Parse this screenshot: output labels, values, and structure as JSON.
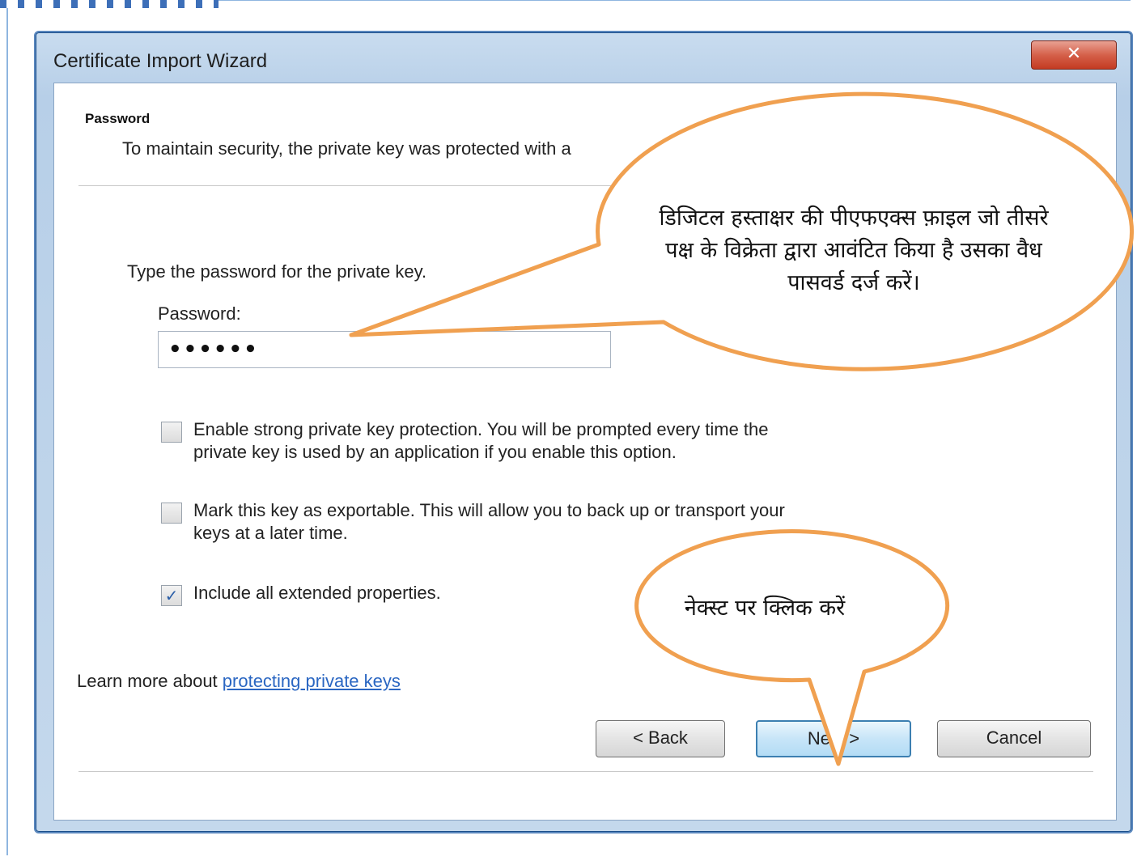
{
  "window": {
    "title": "Certificate Import Wizard",
    "close_label": "✕"
  },
  "header": {
    "title": "Password",
    "description": "To maintain security, the private key was protected with a"
  },
  "form": {
    "instruction": "Type the password for the private key.",
    "password_label": "Password:",
    "password_value": "••••••"
  },
  "options": [
    {
      "label_line1": "Enable strong private key protection. You will be prompted every time the",
      "label_line2": "private key is used by an application if you enable this option.",
      "checked": false,
      "mark": ""
    },
    {
      "label_line1": "Mark this key as exportable. This will allow you to back up or transport your",
      "label_line2": "keys at a later time.",
      "checked": false,
      "mark": ""
    },
    {
      "label_line1": "Include all extended properties.",
      "label_line2": "",
      "checked": true,
      "mark": "✓"
    }
  ],
  "learn_more": {
    "prefix": "Learn more about ",
    "link": "protecting private keys"
  },
  "buttons": {
    "back": "< Back",
    "next": "Next >",
    "cancel": "Cancel"
  },
  "callouts": {
    "password_hint": "डिजिटल हस्ताक्षर की पीएफएक्स फ़ाइल जो तीसरे पक्ष के विक्रेता द्वारा आवंटित किया है उसका वैध पासवर्ड दर्ज करें।",
    "next_hint": "नेक्स्ट पर क्लिक करें"
  },
  "colors": {
    "callout_border": "#f0a050",
    "window_frame": "#5a87bd",
    "link": "#2a66c2"
  }
}
